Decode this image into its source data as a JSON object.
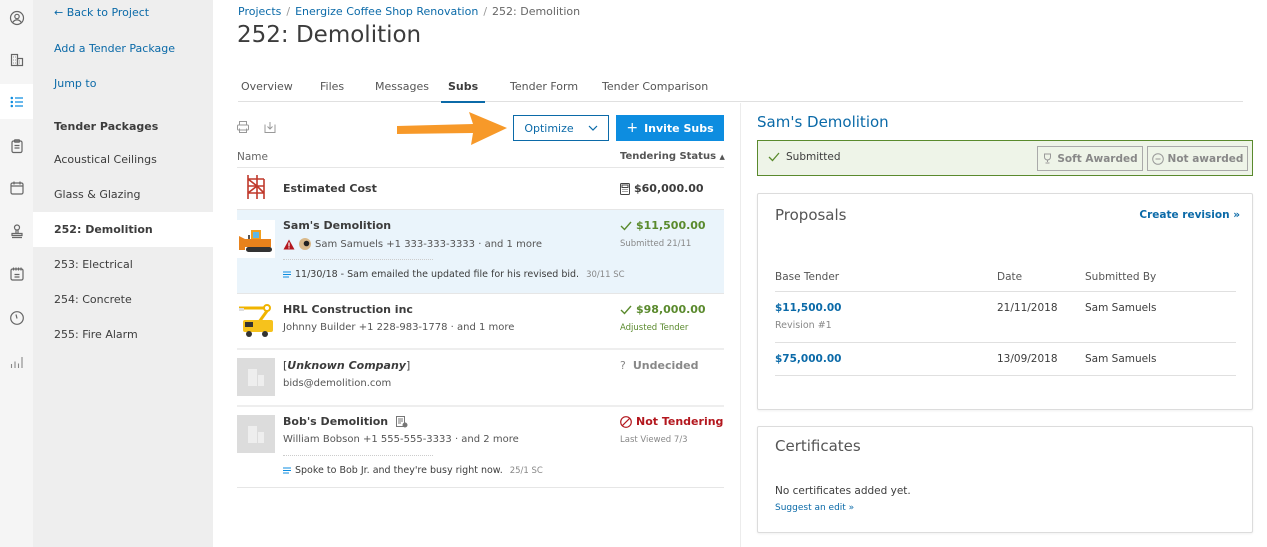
{
  "rail": {
    "items": [
      {
        "icon": "user-circle-icon"
      },
      {
        "icon": "buildings-icon"
      },
      {
        "icon": "list-icon",
        "active": true
      },
      {
        "icon": "clipboard-icon"
      },
      {
        "icon": "calendar-icon"
      },
      {
        "icon": "stamp-icon"
      },
      {
        "icon": "schedule-icon"
      },
      {
        "icon": "clock-icon"
      },
      {
        "icon": "bar-chart-icon"
      }
    ]
  },
  "sidenav": {
    "back_label": "← Back to Project",
    "add_label": "Add a Tender Package",
    "jump_label": "Jump to",
    "section_heading": "Tender Packages",
    "packages": [
      {
        "label": "Acoustical Ceilings"
      },
      {
        "label": "Glass & Glazing"
      },
      {
        "label": "252: Demolition",
        "active": true
      },
      {
        "label": "253: Electrical"
      },
      {
        "label": "254: Concrete"
      },
      {
        "label": "255: Fire Alarm"
      }
    ]
  },
  "breadcrumb": {
    "items": [
      "Projects",
      "Energize Coffee Shop Renovation",
      "252: Demolition"
    ],
    "separator": "/"
  },
  "page_title": "252: Demolition",
  "tabs": [
    {
      "label": "Overview"
    },
    {
      "label": "Files"
    },
    {
      "label": "Messages"
    },
    {
      "label": "Subs",
      "active": true
    },
    {
      "label": "Tender Form"
    },
    {
      "label": "Tender Comparison"
    }
  ],
  "toolbar": {
    "optimize_label": "Optimize",
    "invite_label": "Invite Subs",
    "invite_icon": "+",
    "arrow_color": "#f7941d"
  },
  "list": {
    "col_name": "Name",
    "col_status": "Tendering Status",
    "estimated": {
      "name": "Estimated Cost",
      "amount": "$60,000.00"
    },
    "rows": [
      {
        "name": "Sam's Demolition",
        "contact": "Sam Samuels +1 333-333-3333 · and 1 more",
        "note": "11/30/18 - Sam emailed the updated file for his revised bid.",
        "note_meta": "30/11 SC",
        "amount": "$11,500.00",
        "status": "Submitted 21/11",
        "warning": true
      },
      {
        "name": "HRL Construction inc",
        "contact": "Johnny Builder +1 228-983-1778 · and 1 more",
        "amount": "$98,000.00",
        "status": "Adjusted Tender"
      },
      {
        "name_prefix": "[",
        "name": "Unknown Company",
        "name_suffix": "]",
        "contact": "bids@demolition.com",
        "status_label": "Undecided",
        "status_icon": "?"
      },
      {
        "name": "Bob's Demolition",
        "contact": "William Bobson +1 555-555-3333 · and 2 more",
        "note": "Spoke to Bob Jr. and they're busy right now.",
        "note_meta": "25/1 SC",
        "status_label": "Not Tendering",
        "status": "Last Viewed 7/3"
      }
    ]
  },
  "detail": {
    "title": "Sam's Demolition",
    "status": "Submitted",
    "soft_awarded_label": "Soft Awarded",
    "not_awarded_label": "Not awarded",
    "proposals": {
      "title": "Proposals",
      "create_revision": "Create revision »",
      "headers": [
        "Base Tender",
        "Date",
        "Submitted By"
      ],
      "rows": [
        {
          "amount": "$11,500.00",
          "sub": "Revision #1",
          "date": "21/11/2018",
          "by": "Sam Samuels"
        },
        {
          "amount": "$75,000.00",
          "date": "13/09/2018",
          "by": "Sam Samuels"
        }
      ]
    },
    "certificates": {
      "title": "Certificates",
      "empty": "No certificates added yet.",
      "suggest": "Suggest an edit »"
    }
  },
  "colors": {
    "accent": "#0b6aa8",
    "primary_button": "#0d8de0",
    "success": "#5a8a2d",
    "danger": "#b3171e",
    "selected_row": "#eaf4fb"
  }
}
